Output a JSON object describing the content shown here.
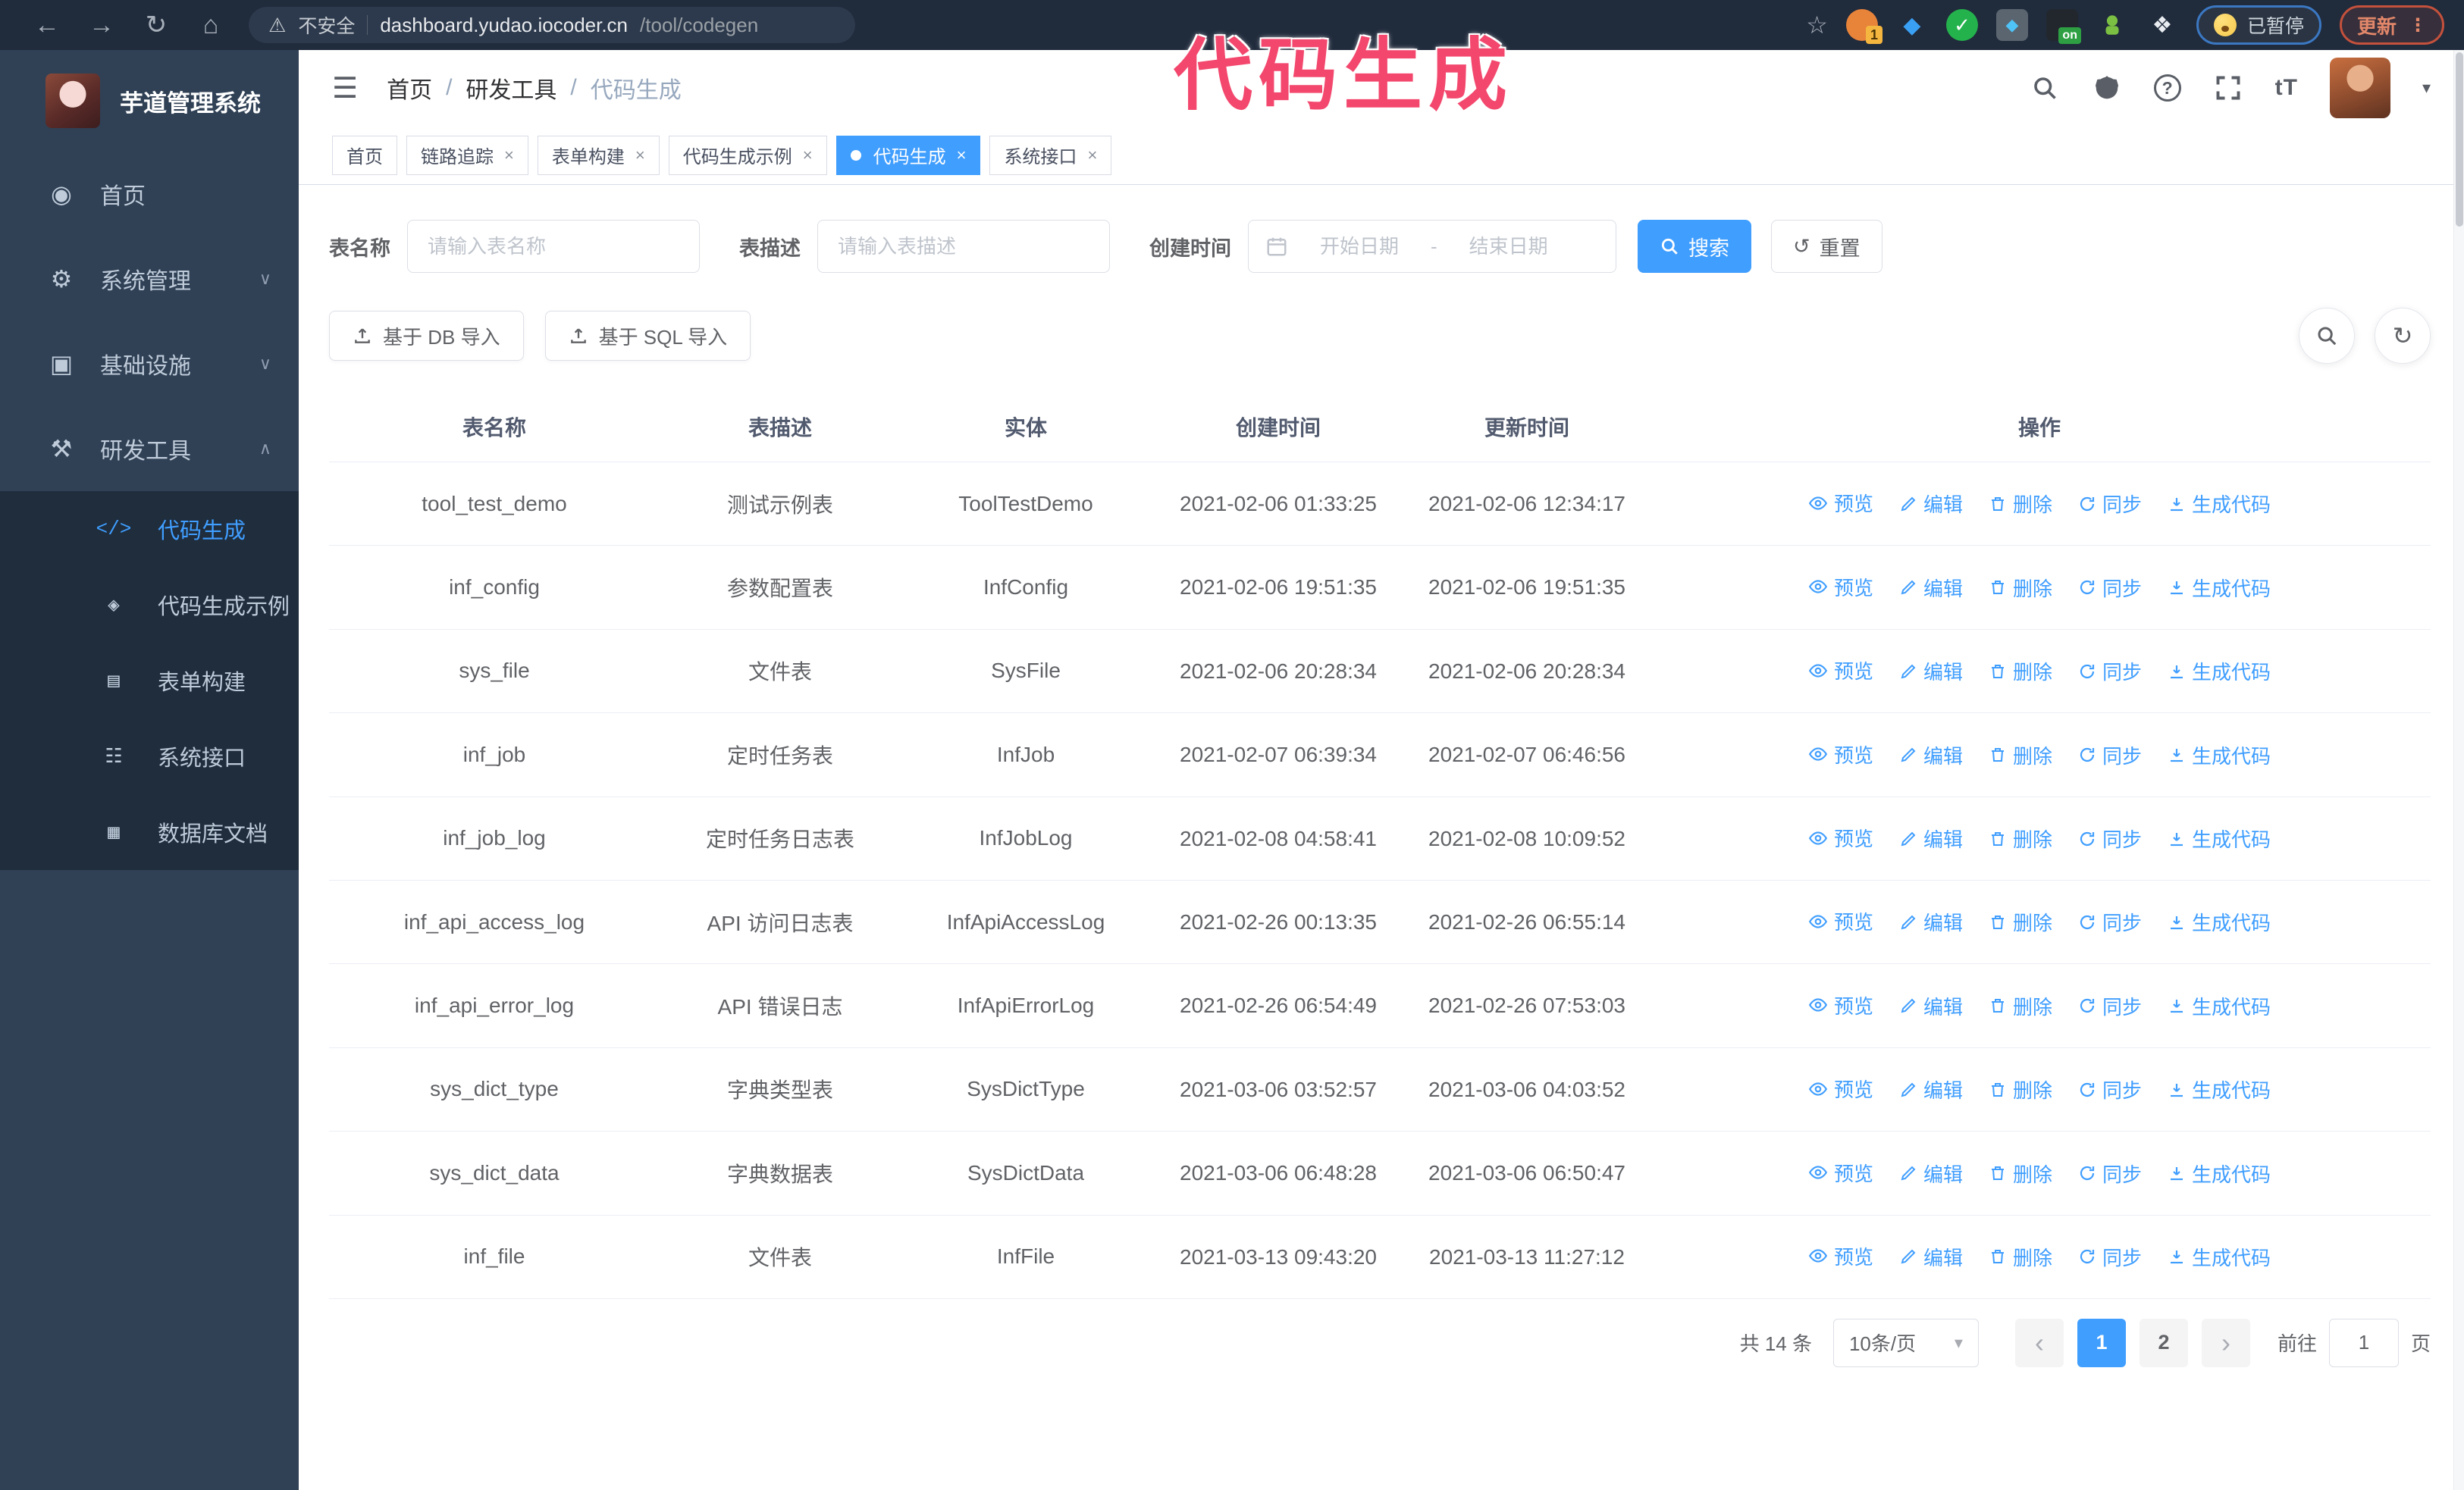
{
  "annotation": {
    "text": "代码生成",
    "color": "#f3476d"
  },
  "browser": {
    "security_label": "不安全",
    "url_host": "dashboard.yudao.iocoder.cn",
    "url_path": "/tool/codegen",
    "extension_badge": "1",
    "extension_on_label": "on",
    "paused_badge": "已暂停",
    "update_button": "更新"
  },
  "sidebar": {
    "app_title": "芋道管理系统",
    "items": [
      {
        "label": "首页"
      },
      {
        "label": "系统管理"
      },
      {
        "label": "基础设施"
      },
      {
        "label": "研发工具"
      }
    ],
    "submenu": [
      {
        "label": "代码生成"
      },
      {
        "label": "代码生成示例"
      },
      {
        "label": "表单构建"
      },
      {
        "label": "系统接口"
      },
      {
        "label": "数据库文档"
      }
    ]
  },
  "header": {
    "breadcrumb": [
      "首页",
      "研发工具",
      "代码生成"
    ]
  },
  "tabs": [
    {
      "label": "首页"
    },
    {
      "label": "链路追踪"
    },
    {
      "label": "表单构建"
    },
    {
      "label": "代码生成示例"
    },
    {
      "label": "代码生成"
    },
    {
      "label": "系统接口"
    }
  ],
  "filters": {
    "name_label": "表名称",
    "name_placeholder": "请输入表名称",
    "desc_label": "表描述",
    "desc_placeholder": "请输入表描述",
    "time_label": "创建时间",
    "start_placeholder": "开始日期",
    "end_placeholder": "结束日期",
    "range_separator": "-",
    "search_label": "搜索",
    "reset_label": "重置"
  },
  "toolbar": {
    "import_db": "基于 DB 导入",
    "import_sql": "基于 SQL 导入"
  },
  "table": {
    "columns": [
      "表名称",
      "表描述",
      "实体",
      "创建时间",
      "更新时间",
      "操作"
    ],
    "actions": [
      "预览",
      "编辑",
      "删除",
      "同步",
      "生成代码"
    ],
    "rows": [
      {
        "name": "tool_test_demo",
        "desc": "测试示例表",
        "entity": "ToolTestDemo",
        "created": "2021-02-06 01:33:25",
        "updated": "2021-02-06 12:34:17"
      },
      {
        "name": "inf_config",
        "desc": "参数配置表",
        "entity": "InfConfig",
        "created": "2021-02-06 19:51:35",
        "updated": "2021-02-06 19:51:35"
      },
      {
        "name": "sys_file",
        "desc": "文件表",
        "entity": "SysFile",
        "created": "2021-02-06 20:28:34",
        "updated": "2021-02-06 20:28:34"
      },
      {
        "name": "inf_job",
        "desc": "定时任务表",
        "entity": "InfJob",
        "created": "2021-02-07 06:39:34",
        "updated": "2021-02-07 06:46:56"
      },
      {
        "name": "inf_job_log",
        "desc": "定时任务日志表",
        "entity": "InfJobLog",
        "created": "2021-02-08 04:58:41",
        "updated": "2021-02-08 10:09:52"
      },
      {
        "name": "inf_api_access_log",
        "desc": "API 访问日志表",
        "entity": "InfApiAccessLog",
        "created": "2021-02-26 00:13:35",
        "updated": "2021-02-26 06:55:14"
      },
      {
        "name": "inf_api_error_log",
        "desc": "API 错误日志",
        "entity": "InfApiErrorLog",
        "created": "2021-02-26 06:54:49",
        "updated": "2021-02-26 07:53:03"
      },
      {
        "name": "sys_dict_type",
        "desc": "字典类型表",
        "entity": "SysDictType",
        "created": "2021-03-06 03:52:57",
        "updated": "2021-03-06 04:03:52"
      },
      {
        "name": "sys_dict_data",
        "desc": "字典数据表",
        "entity": "SysDictData",
        "created": "2021-03-06 06:48:28",
        "updated": "2021-03-06 06:50:47"
      },
      {
        "name": "inf_file",
        "desc": "文件表",
        "entity": "InfFile",
        "created": "2021-03-13 09:43:20",
        "updated": "2021-03-13 11:27:12"
      }
    ]
  },
  "pagination": {
    "total": "共 14 条",
    "page_size": "10条/页",
    "pages": [
      "1",
      "2"
    ],
    "active_page": "1",
    "goto_label": "前往",
    "goto_value": "1",
    "page_label": "页"
  },
  "colors": {
    "primary": "#409eff",
    "sidebar_bg": "#304156",
    "submenu_bg": "#1f2d3d",
    "annotation_pink": "#f3476d",
    "paused_badge_border": "#3b78c2",
    "update_button_border": "#c4513c"
  }
}
